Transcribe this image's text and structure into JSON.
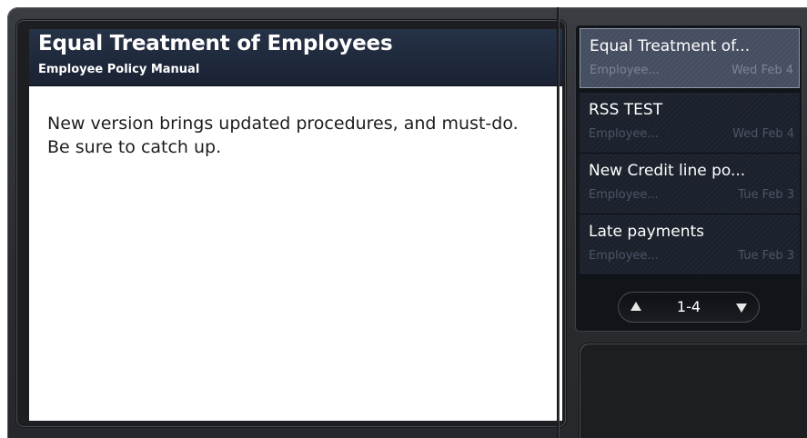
{
  "article": {
    "title": "Equal Treatment of Employees",
    "subtitle": "Employee Policy Manual",
    "body": "New version brings updated procedures, and must-do. Be sure to catch up."
  },
  "news_list": {
    "items": [
      {
        "title": "Equal Treatment of...",
        "source": "Employee...",
        "date": "Wed Feb 4",
        "selected": true
      },
      {
        "title": "RSS TEST",
        "source": "Employee...",
        "date": "Wed Feb 4",
        "selected": false
      },
      {
        "title": "New Credit line po...",
        "source": "Employee...",
        "date": "Tue Feb 3",
        "selected": false
      },
      {
        "title": "Late payments",
        "source": "Employee...",
        "date": "Tue Feb 3",
        "selected": false
      }
    ],
    "pager": {
      "label": "1-4",
      "prev_icon": "triangle-up-icon",
      "next_icon": "triangle-down-icon"
    }
  }
}
